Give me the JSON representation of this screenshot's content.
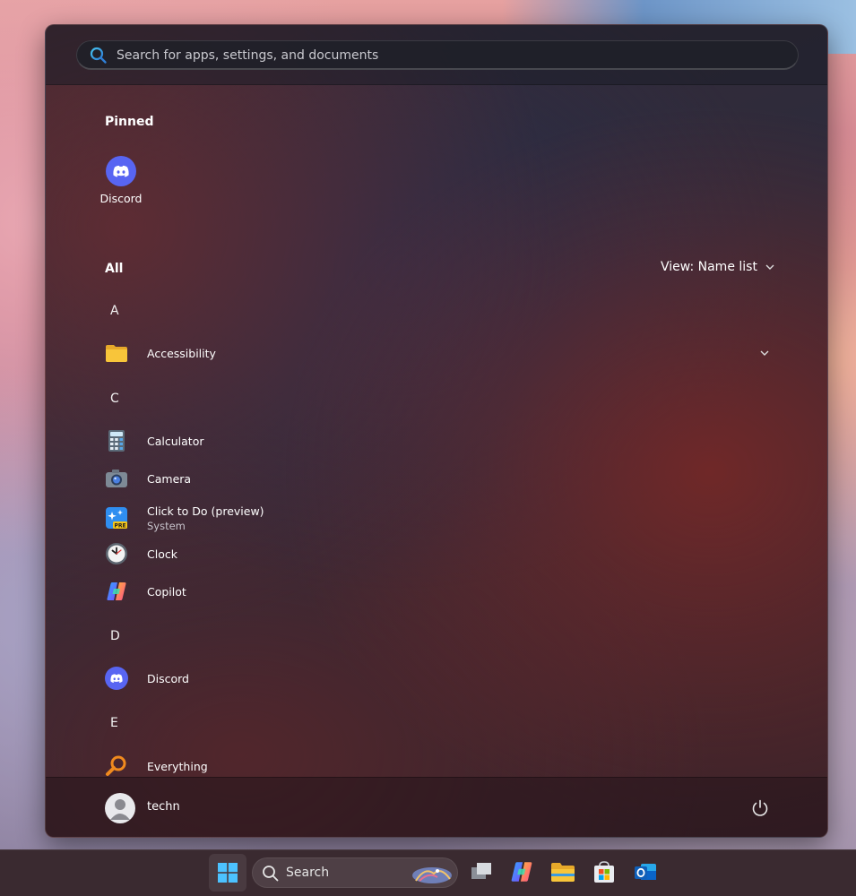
{
  "search": {
    "placeholder": "Search for apps, settings, and documents"
  },
  "pinned": {
    "title": "Pinned",
    "apps": [
      {
        "label": "Discord",
        "icon": "discord-icon"
      }
    ]
  },
  "all": {
    "title": "All",
    "view_label": "View: Name list",
    "groups": [
      {
        "letter": "A",
        "apps": [
          {
            "name": "Accessibility",
            "icon": "folder-icon",
            "expandable": true
          }
        ]
      },
      {
        "letter": "C",
        "apps": [
          {
            "name": "Calculator",
            "icon": "calculator-icon"
          },
          {
            "name": "Camera",
            "icon": "camera-icon"
          },
          {
            "name": "Click to Do (preview)",
            "sub": "System",
            "icon": "click-to-do-icon",
            "badge": "PRE"
          },
          {
            "name": "Clock",
            "icon": "clock-icon"
          },
          {
            "name": "Copilot",
            "icon": "copilot-icon"
          }
        ]
      },
      {
        "letter": "D",
        "apps": [
          {
            "name": "Discord",
            "icon": "discord-icon"
          }
        ]
      },
      {
        "letter": "E",
        "apps": [
          {
            "name": "Everything",
            "icon": "everything-icon"
          }
        ]
      }
    ]
  },
  "footer": {
    "username": "techn",
    "power_icon": "power-icon"
  },
  "taskbar": {
    "search_label": "Search",
    "icons": [
      "start-icon",
      "search-icon",
      "task-view-icon",
      "copilot-icon",
      "file-explorer-icon",
      "microsoft-store-icon",
      "outlook-icon"
    ]
  },
  "colors": {
    "discord": "#5865F2",
    "folder": "#F8C53A",
    "accent_blue": "#3B9BE0"
  }
}
